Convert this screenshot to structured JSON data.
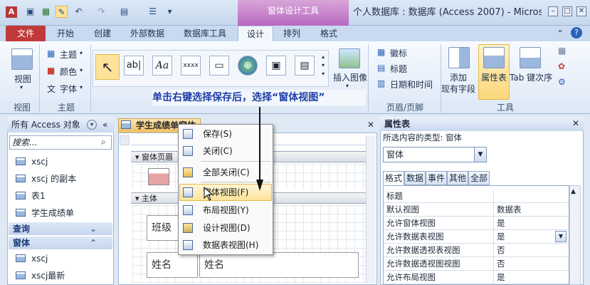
{
  "window": {
    "title": "个人数据库 : 数据库 (Access 2007) - Microso...",
    "context_tab_header": "窗体设计工具"
  },
  "ribbon_tabs": [
    "文件",
    "开始",
    "创建",
    "外部数据",
    "数据库工具",
    "设计",
    "排列",
    "格式"
  ],
  "ribbon": {
    "views": {
      "btn": "视图",
      "group": "视图"
    },
    "themes": {
      "items": [
        "主题",
        "颜色",
        "字体"
      ],
      "group": "主题"
    },
    "controls": {
      "insert_image": "插入图像"
    },
    "header_footer": {
      "items": [
        "徽标",
        "标题",
        "日期和时间"
      ],
      "group": "页眉/页脚"
    },
    "tools": {
      "add_field_line1": "添加",
      "add_field_line2": "现有字段",
      "property_sheet": "属性表",
      "tab_order": "Tab 键次序",
      "group": "工具"
    }
  },
  "annotation": "单击右键选择保存后，选择“窗体视图”",
  "nav_pane": {
    "title": "所有 Access 对象",
    "search_placeholder": "搜索...",
    "tables": [
      "xscj",
      "xscj 的副本",
      "表1",
      "学生成绩单"
    ],
    "section_query": "查询",
    "section_form": "窗体",
    "forms": [
      "xscj",
      "xscj最新"
    ]
  },
  "document": {
    "tab_title": "学生成绩单窗体",
    "section_header": "窗体页眉",
    "section_body": "主体",
    "labels": [
      "班级",
      "姓名",
      "姓名"
    ]
  },
  "context_menu": {
    "items": [
      "保存(S)",
      "关闭(C)",
      "全部关闭(C)",
      "窗体视图(F)",
      "布局视图(Y)",
      "设计视图(D)",
      "数据表视图(H)"
    ]
  },
  "property_sheet": {
    "title": "属性表",
    "selection_type": "所选内容的类型: 窗体",
    "selected_object": "窗体",
    "tabs": [
      "格式",
      "数据",
      "事件",
      "其他",
      "全部"
    ],
    "rows": [
      {
        "k": "标题",
        "v": ""
      },
      {
        "k": "默认视图",
        "v": "数据表"
      },
      {
        "k": "允许窗体视图",
        "v": "是"
      },
      {
        "k": "允许数据表视图",
        "v": "是"
      },
      {
        "k": "允许数据透视表视图",
        "v": "否"
      },
      {
        "k": "允许数据透视图视图",
        "v": "否"
      },
      {
        "k": "允许布局视图",
        "v": "是"
      }
    ]
  },
  "colors": {
    "file_tab": "#c03a3a",
    "context_tab": "#b968c0",
    "highlight": "#fde39a",
    "annotation": "#1f3fa8"
  }
}
